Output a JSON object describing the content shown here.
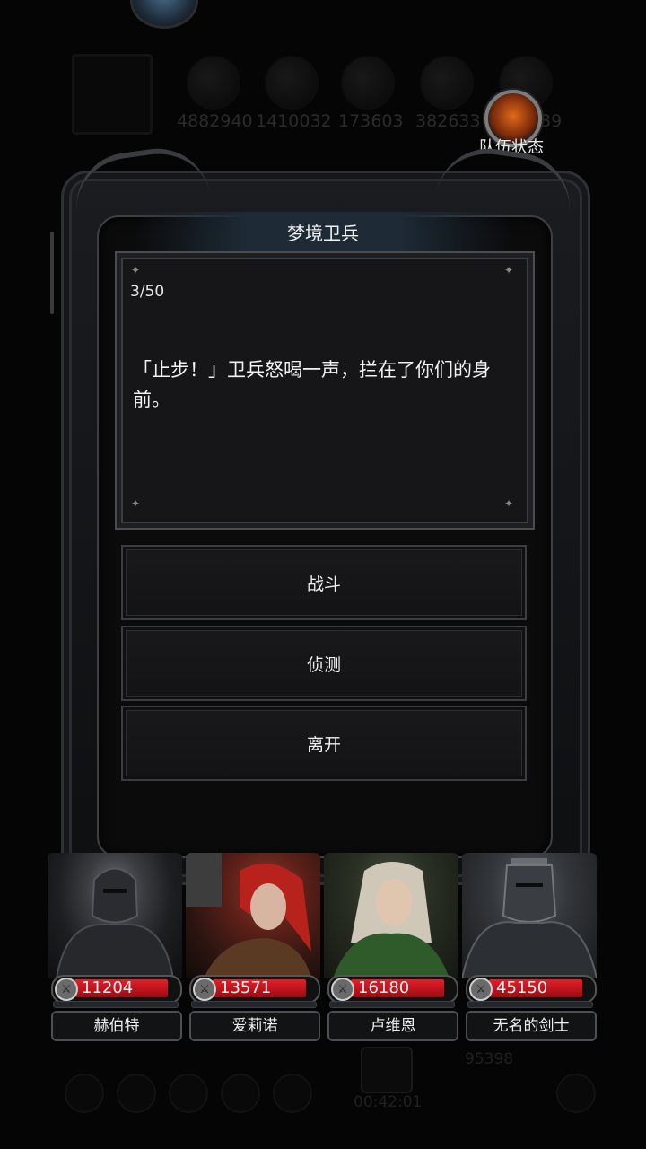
{
  "background": {
    "resources": [
      "4882940",
      "1410032",
      "173603",
      "382633",
      "339"
    ],
    "bottom_timer": "00:42:01",
    "bottom_count": "95398"
  },
  "team_status": {
    "label": "队伍状态"
  },
  "event": {
    "title": "梦境卫兵",
    "counter": "3/50",
    "text": "「止步！」卫兵怒喝一声，拦在了你们的身前。"
  },
  "choices": [
    {
      "label": "战斗"
    },
    {
      "label": "侦测"
    },
    {
      "label": "离开"
    }
  ],
  "heroes": [
    {
      "name": "赫伯特",
      "power": "11204"
    },
    {
      "name": "爱莉诺",
      "power": "13571"
    },
    {
      "name": "卢维恩",
      "power": "16180"
    },
    {
      "name": "无名的剑士",
      "power": "45150"
    }
  ],
  "icons": {
    "top": "bird-icon",
    "team_status": "flame-orb-icon",
    "power": "sword-icon"
  },
  "colors": {
    "hp_bar": "#e4202a",
    "frame": "#3d3f43"
  }
}
